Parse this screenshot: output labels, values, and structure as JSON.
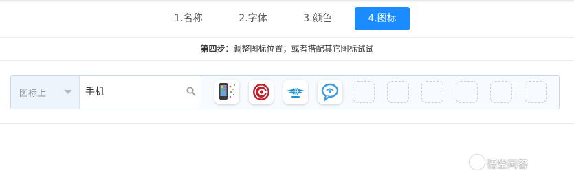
{
  "steps": [
    {
      "label": "1.名称",
      "active": false
    },
    {
      "label": "2.字体",
      "active": false
    },
    {
      "label": "3.颜色",
      "active": false
    },
    {
      "label": "4.图标",
      "active": true
    }
  ],
  "hint": {
    "step": "第四步：",
    "text": "调整图标位置；或者搭配其它图标试试"
  },
  "toolbar": {
    "position_select": {
      "value": "图标上"
    },
    "search": {
      "value": "手机",
      "icon": "search-icon"
    },
    "icons": [
      {
        "name": "phone-apps-icon"
      },
      {
        "name": "red-c-logo-icon"
      },
      {
        "name": "winged-globe-icon"
      },
      {
        "name": "chat-bubble-icon"
      }
    ],
    "empty_slots": 6
  },
  "watermark": {
    "text": "悟空问答"
  },
  "colors": {
    "accent": "#1a8cff",
    "toolbar_border": "#c5d7ea",
    "toolbar_bg": "#f7fbff"
  }
}
